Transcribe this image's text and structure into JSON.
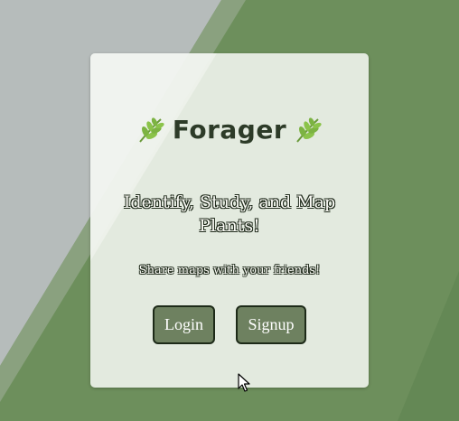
{
  "app": {
    "name": "Forager",
    "tagline": "Identify, Study, and Map Plants!",
    "subtext": "Share maps with your friends!"
  },
  "buttons": {
    "login_label": "Login",
    "signup_label": "Signup"
  },
  "icons": {
    "left_leaf": "leaf-icon",
    "right_leaf": "leaf-icon",
    "cursor": "mouse-pointer-icon"
  },
  "colors": {
    "background_green": "#6d8f5c",
    "background_gray": "#b6bcbb",
    "card": "#ecf1ea",
    "brand_text": "#2d3b28",
    "button_fill": "#6e8160",
    "button_border": "#1d2a18"
  }
}
